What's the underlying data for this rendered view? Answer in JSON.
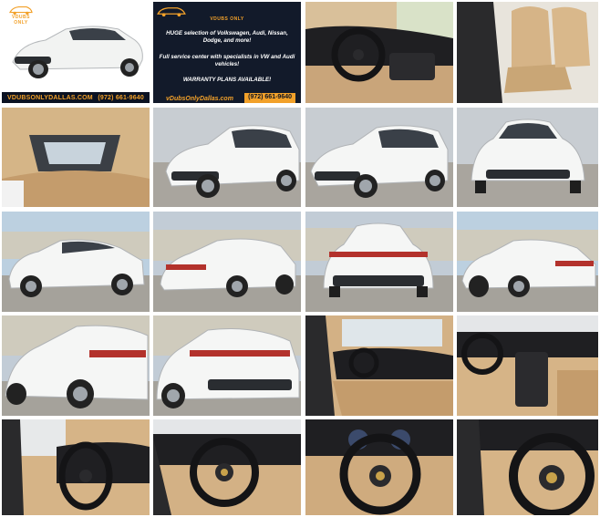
{
  "gallery": {
    "ad_tile_1": {
      "logo_text": "VDUBS ONLY",
      "url": "VDUBSONLYDALLAS.COM",
      "phone": "(972) 661-9640"
    },
    "ad_tile_2": {
      "logo_text": "VDUBS ONLY",
      "line1": "HUGE selection of Volkswagen, Audi, Nissan, Dodge, and more!",
      "line2": "Full service center with specialists in VW and Audi vehicles!",
      "line3": "WARRANTY PLANS AVAILABLE!",
      "url": "vDubsOnlyDallas.com",
      "phone": "(972) 661-9640"
    },
    "vehicle": {
      "body_color": "#f4f5f4",
      "interior_color": "#d7b88c",
      "accent_color": "#f2a12a"
    },
    "photos": [
      {
        "subject": "front-quarter-exterior",
        "icon": "car-front-quarter-icon"
      },
      {
        "subject": "dashboard-passenger-view",
        "icon": "dashboard-icon"
      },
      {
        "subject": "front-seats",
        "icon": "seat-icon"
      },
      {
        "subject": "sunroof-headliner",
        "icon": "sunroof-icon"
      },
      {
        "subject": "front-quarter-exterior",
        "icon": "car-front-quarter-icon"
      },
      {
        "subject": "front-quarter-exterior",
        "icon": "car-front-quarter-icon"
      },
      {
        "subject": "front-exterior",
        "icon": "car-front-icon"
      },
      {
        "subject": "side-profile-exterior",
        "icon": "car-side-icon"
      },
      {
        "subject": "rear-quarter-exterior",
        "icon": "car-rear-quarter-icon"
      },
      {
        "subject": "rear-exterior",
        "icon": "car-rear-icon"
      },
      {
        "subject": "side-profile-exterior",
        "icon": "car-side-icon"
      },
      {
        "subject": "rear-quarter-exterior",
        "icon": "car-rear-quarter-icon"
      },
      {
        "subject": "rear-quarter-exterior",
        "icon": "car-rear-quarter-icon"
      },
      {
        "subject": "interior-door-view",
        "icon": "interior-icon"
      },
      {
        "subject": "center-console",
        "icon": "console-icon"
      },
      {
        "subject": "steering-wheel-side",
        "icon": "steering-wheel-icon"
      },
      {
        "subject": "steering-wheel-side",
        "icon": "steering-wheel-icon"
      },
      {
        "subject": "steering-wheel-front",
        "icon": "steering-wheel-icon"
      },
      {
        "subject": "steering-wheel-close",
        "icon": "steering-wheel-icon"
      }
    ]
  }
}
